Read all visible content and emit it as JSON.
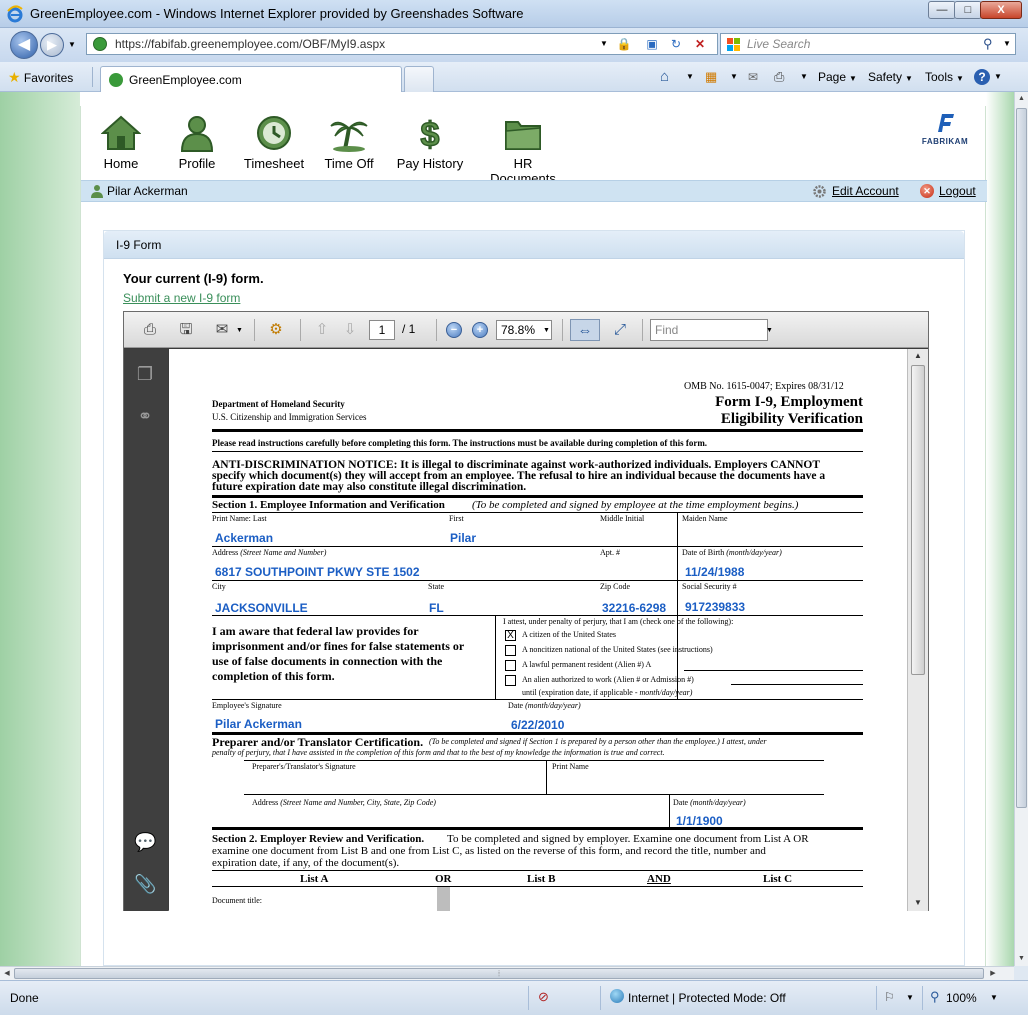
{
  "window": {
    "title": "GreenEmployee.com - Windows Internet Explorer provided by Greenshades Software",
    "minimize": "—",
    "maximize": "□",
    "close": "X"
  },
  "address": {
    "url": "https://fabifab.greenemployee.com/OBF/MyI9.aspx",
    "search_placeholder": "Live Search"
  },
  "tabs": {
    "favorites": "Favorites",
    "active_tab": "GreenEmployee.com"
  },
  "commands": {
    "page": "Page",
    "safety": "Safety",
    "tools": "Tools"
  },
  "site_nav": [
    {
      "label": "Home",
      "icon": "home-icon"
    },
    {
      "label": "Profile",
      "icon": "profile-icon"
    },
    {
      "label": "Timesheet",
      "icon": "clock-icon"
    },
    {
      "label": "Time Off",
      "icon": "palm-tree-icon"
    },
    {
      "label": "Pay History",
      "icon": "dollar-icon"
    },
    {
      "label": "HR Documents",
      "icon": "folder-icon"
    }
  ],
  "brand": {
    "name": "FABRIKAM"
  },
  "userbar": {
    "user": "Pilar Ackerman",
    "edit_account": "Edit Account",
    "logout": "Logout"
  },
  "panel": {
    "title": "I-9 Form",
    "current": "Your current (I-9) form.",
    "submit_link": "Submit a new I-9 form"
  },
  "pdf_viewer": {
    "page_current": "1",
    "page_total": "/ 1",
    "zoom": "78.8%",
    "find_placeholder": "Find"
  },
  "form": {
    "omb": "OMB No. 1615-0047; Expires 08/31/12",
    "title1": "Form I-9, Employment",
    "title2": "Eligibility Verification",
    "dept1": "Department of Homeland Security",
    "dept2": "U.S. Citizenship and Immigration Services",
    "instructions": "Please read instructions carefully before completing this form.  The instructions must be available during completion of this form.",
    "anti1": "ANTI-DISCRIMINATION NOTICE:  It is illegal to discriminate against work-authorized individuals. Employers CANNOT",
    "anti2": "specify which document(s) they will accept from an employee.  The refusal to hire an individual because the documents have  a",
    "anti3": "future expiration date may also constitute illegal discrimination.",
    "section1_title": "Section 1. Employee Information and Verification",
    "section1_note": "(To be completed and signed by employee at the time employment begins.)",
    "lbl_print_name": "Print Name:   Last",
    "lbl_first": "First",
    "lbl_middle": "Middle Initial",
    "lbl_maiden": "Maiden Name",
    "last_name": "Ackerman",
    "first_name": "Pilar",
    "lbl_address": "Address",
    "lbl_address_note": "(Street Name and Number)",
    "lbl_apt": "Apt. #",
    "lbl_dob": "Date of Birth",
    "lbl_dob_note": "(month/day/year)",
    "address": "6817 SOUTHPOINT PKWY STE 1502",
    "dob": "11/24/1988",
    "lbl_city": "City",
    "lbl_state": "State",
    "lbl_zip": "Zip Code",
    "lbl_ssn": "Social Security #",
    "city": "JACKSONVILLE",
    "state": "FL",
    "zip": "32216-6298",
    "ssn": "917239833",
    "aware1": "I am aware that federal law provides for",
    "aware2": "imprisonment and/or fines for false statements or",
    "aware3": "use of false documents in connection with the",
    "aware4": "completion of this form.",
    "attest": "I attest, under penalty of perjury, that I am (check one of the following):",
    "opt_citizen": "A citizen of the United States",
    "opt_noncitizen": "A noncitizen national of the United States (see instructions)",
    "opt_lpr": "A lawful permanent resident (Alien #) A",
    "opt_alien": "An alien authorized to work (Alien # or Admission #)",
    "until": "until (expiration date, if applicable -",
    "until_note": "month/day/year)",
    "check_mark": "X",
    "lbl_emp_sig": "Employee's Signature",
    "lbl_date": "Date",
    "lbl_date_note": "(month/day/year)",
    "emp_sig": "Pilar Ackerman",
    "emp_date": "6/22/2010",
    "prep_title": "Preparer and/or Translator Certification.",
    "prep_text1": "(To be completed and signed if Section 1 is prepared by a person other than the employee.) I attest, under",
    "prep_text2": "penalty of perjury, that I have assisted in the completion of this form and that to the best of my knowledge the information is true and correct.",
    "lbl_prep_sig": "Preparer's/Translator's Signature",
    "lbl_print_name2": "Print Name",
    "lbl_prep_addr": "Address",
    "lbl_prep_addr_note": "(Street Name and Number, City, State, Zip Code)",
    "lbl_prep_date": "Date",
    "lbl_prep_date_note": "(month/day/year)",
    "prep_date": "1/1/1900",
    "section2_title": "Section 2. Employer Review and Verification.",
    "section2_text1": "To be completed and signed by employer. Examine one document from List A OR",
    "section2_text2": "examine one document from List B and one from List C, as listed on the reverse of this form, and record the title, number and",
    "section2_text3": "expiration date, if any, of the document(s).",
    "list_a": "List A",
    "or": "OR",
    "list_b": "List B",
    "and": "AND",
    "list_c": "List C",
    "doc_title": "Document title:"
  },
  "status": {
    "done": "Done",
    "zone": "Internet | Protected Mode: Off",
    "zoom": "100%"
  }
}
